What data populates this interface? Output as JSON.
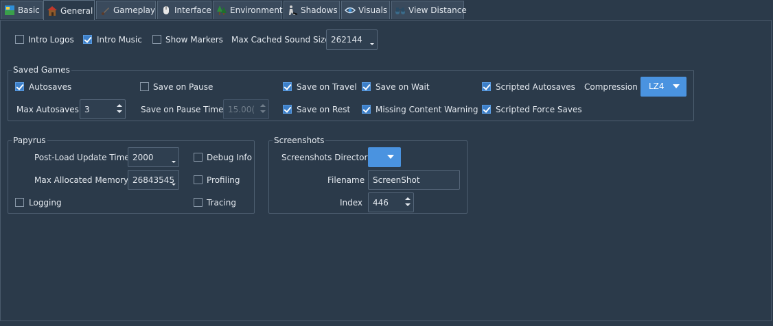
{
  "tabs": [
    {
      "label": "Basic",
      "icon": "basic-icon"
    },
    {
      "label": "General",
      "icon": "house-icon",
      "active": true
    },
    {
      "label": "Gameplay",
      "icon": "gameplay-icon"
    },
    {
      "label": "Interface",
      "icon": "mouse-icon"
    },
    {
      "label": "Environment",
      "icon": "trees-icon"
    },
    {
      "label": "Shadows",
      "icon": "shadow-figure-icon"
    },
    {
      "label": "Visuals",
      "icon": "eye-icon"
    },
    {
      "label": "View Distance",
      "icon": "binoculars-icon"
    }
  ],
  "general": {
    "intro_logos": {
      "label": "Intro Logos",
      "checked": false
    },
    "intro_music": {
      "label": "Intro Music",
      "checked": true
    },
    "show_markers": {
      "label": "Show Markers",
      "checked": false
    },
    "max_cached_sound_size": {
      "label": "Max Cached Sound Size",
      "value": "262144"
    }
  },
  "saved_games": {
    "title": "Saved Games",
    "autosaves": {
      "label": "Autosaves",
      "checked": true
    },
    "save_on_pause": {
      "label": "Save on Pause",
      "checked": false
    },
    "save_on_travel": {
      "label": "Save on Travel",
      "checked": true
    },
    "save_on_wait": {
      "label": "Save on Wait",
      "checked": true
    },
    "scripted_autosaves": {
      "label": "Scripted Autosaves",
      "checked": true
    },
    "compression": {
      "label": "Compression",
      "value": "LZ4"
    },
    "max_autosaves": {
      "label": "Max Autosaves",
      "value": "3"
    },
    "save_on_pause_timer": {
      "label": "Save on Pause Timer",
      "value": "15.00("
    },
    "save_on_rest": {
      "label": "Save on Rest",
      "checked": true
    },
    "missing_content_warning": {
      "label": "Missing Content Warning",
      "checked": true
    },
    "scripted_force_saves": {
      "label": "Scripted Force Saves",
      "checked": true
    }
  },
  "papyrus": {
    "title": "Papyrus",
    "post_load_update_time": {
      "label": "Post-Load Update Time",
      "value": "2000"
    },
    "max_allocated_memory": {
      "label": "Max Allocated Memory",
      "value": "26843545"
    },
    "debug_info": {
      "label": "Debug Info",
      "checked": false
    },
    "profiling": {
      "label": "Profiling",
      "checked": false
    },
    "logging": {
      "label": "Logging",
      "checked": false
    },
    "tracing": {
      "label": "Tracing",
      "checked": false
    }
  },
  "screenshots": {
    "title": "Screenshots",
    "directory": {
      "label": "Screenshots Directory",
      "value": ""
    },
    "filename": {
      "label": "Filename",
      "value": "ScreenShot"
    },
    "index": {
      "label": "Index",
      "value": "446"
    }
  },
  "colors": {
    "background": "#2b3a4a",
    "accent": "#4a93e0",
    "check": "#3c7fc9"
  }
}
